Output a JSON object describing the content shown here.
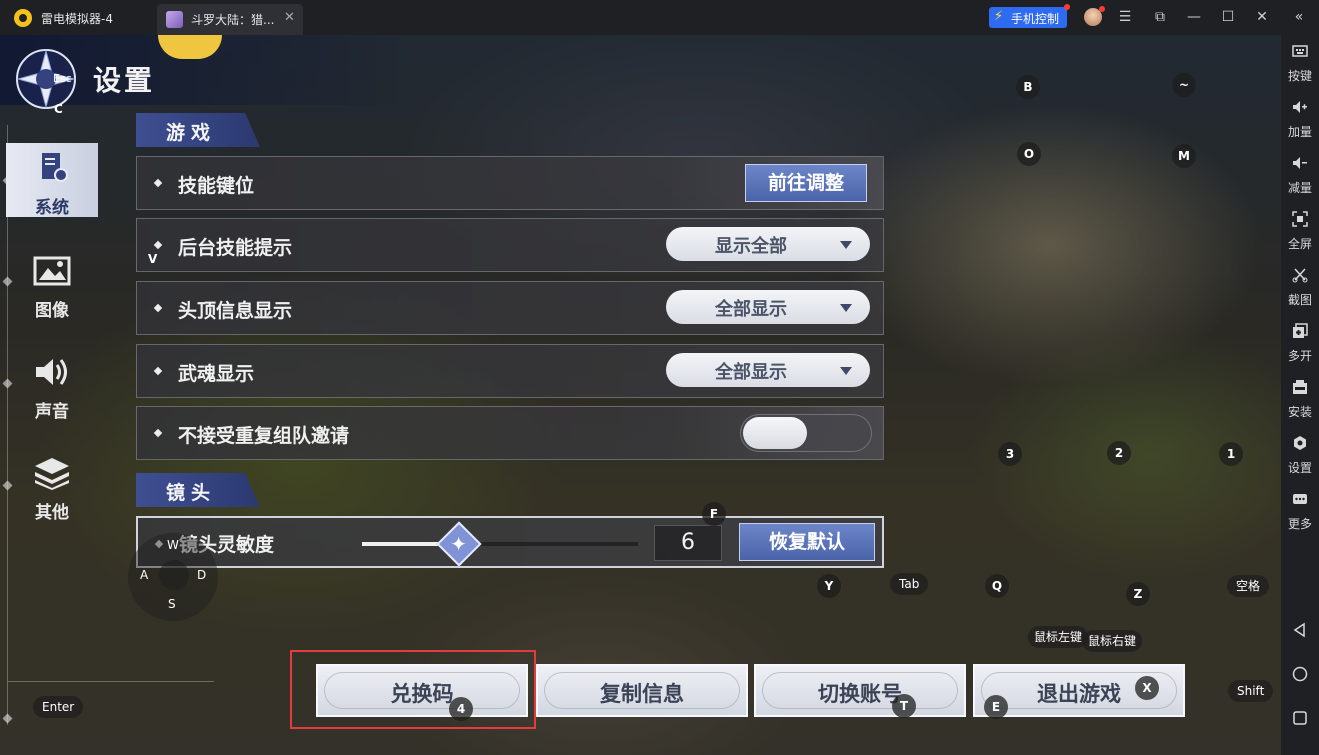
{
  "titlebar": {
    "app_name": "雷电模拟器-4",
    "tab_label": "斗罗大陆：猎...",
    "phone_control_label": "手机控制"
  },
  "settings": {
    "title": "设置",
    "nav": [
      {
        "label": "系统",
        "icon": "document-gear-icon",
        "active": true
      },
      {
        "label": "图像",
        "icon": "image-icon",
        "active": false
      },
      {
        "label": "声音",
        "icon": "speaker-icon",
        "active": false
      },
      {
        "label": "其他",
        "icon": "layers-icon",
        "active": false
      }
    ],
    "sections": {
      "game": "游戏",
      "camera": "镜头"
    },
    "rows": {
      "skill_keys": {
        "label": "技能键位",
        "button": "前往调整"
      },
      "bg_skill_tip": {
        "label": "后台技能提示",
        "value": "显示全部"
      },
      "head_info": {
        "label": "头顶信息显示",
        "value": "全部显示"
      },
      "wuhun": {
        "label": "武魂显示",
        "value": "全部显示"
      },
      "no_repeat_invite": {
        "label": "不接受重复组队邀请",
        "on": false
      },
      "camera_sens": {
        "label": "镜头灵敏度",
        "value": "6",
        "fraction": 0.35,
        "reset": "恢复默认"
      }
    },
    "bottom_buttons": [
      "兑换码",
      "复制信息",
      "切换账号",
      "退出游戏"
    ]
  },
  "key_hints": {
    "esc": "Esc",
    "c": "C",
    "v": "V",
    "b": "B",
    "tilde": "~",
    "o": "O",
    "m": "M",
    "k3": "3",
    "k2": "2",
    "k1": "1",
    "f": "F",
    "w": "W",
    "a": "A",
    "d": "D",
    "s": "S",
    "y": "Y",
    "tab": "Tab",
    "q": "Q",
    "z": "Z",
    "space": "空格",
    "mouse_left": "鼠标左键",
    "mouse_right": "鼠标右键",
    "enter": "Enter",
    "k4": "4",
    "t": "T",
    "e": "E",
    "x": "X",
    "shift": "Shift"
  },
  "toolbar": [
    {
      "label": "按键",
      "icon": "keyboard-icon"
    },
    {
      "label": "加量",
      "icon": "volume-up-icon"
    },
    {
      "label": "减量",
      "icon": "volume-down-icon"
    },
    {
      "label": "全屏",
      "icon": "fullscreen-icon"
    },
    {
      "label": "截图",
      "icon": "scissors-icon"
    },
    {
      "label": "多开",
      "icon": "multi-instance-icon"
    },
    {
      "label": "安装",
      "icon": "apk-icon"
    },
    {
      "label": "设置",
      "icon": "gear-icon"
    },
    {
      "label": "更多",
      "icon": "more-icon"
    }
  ],
  "colors": {
    "accent_blue": "#4b63a8",
    "section_blue": "#3e4f92",
    "highlight_red": "#e23c3c",
    "phone_btn": "#2f6bf0"
  }
}
